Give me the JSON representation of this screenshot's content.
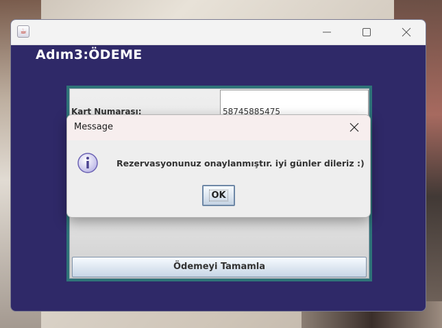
{
  "window": {
    "title": "",
    "heading": "Adım3:ÖDEME"
  },
  "form": {
    "card_number_label": "Kart Numarası:",
    "card_number_value": "58745885475",
    "submit_label": "Ödemeyi Tamamla"
  },
  "dialog": {
    "title": "Message",
    "message": "Rezervasyonunuz onaylanmıştır. iyi günler dileriz :)",
    "ok_label": "OK"
  },
  "colors": {
    "window_background": "#2f2968",
    "panel_border": "#2e7378",
    "heading_text": "#ffffff"
  },
  "icons": {
    "app": "java-icon",
    "dialog": "info-icon"
  }
}
